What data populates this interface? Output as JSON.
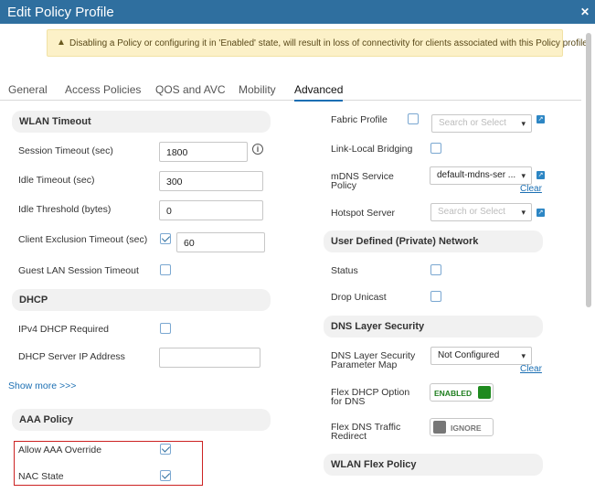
{
  "window": {
    "title": "Edit Policy Profile",
    "close_icon": "close-icon"
  },
  "alert": {
    "text": "Disabling a Policy or configuring it in 'Enabled' state, will result in loss of connectivity for clients associated with this Policy profile.",
    "icon": "warning-icon"
  },
  "tabs": [
    {
      "label": "General",
      "active": false
    },
    {
      "label": "Access Policies",
      "active": false
    },
    {
      "label": "QOS and AVC",
      "active": false
    },
    {
      "label": "Mobility",
      "active": false
    },
    {
      "label": "Advanced",
      "active": true
    }
  ],
  "left": {
    "wlan_timeout": {
      "title": "WLAN Timeout",
      "session_timeout": {
        "label": "Session Timeout (sec)",
        "value": "1800"
      },
      "idle_timeout": {
        "label": "Idle Timeout (sec)",
        "value": "300"
      },
      "idle_threshold": {
        "label": "Idle Threshold (bytes)",
        "value": "0"
      },
      "client_exclusion": {
        "label": "Client Exclusion Timeout (sec)",
        "checked": true,
        "value": "60"
      },
      "guest_lan": {
        "label": "Guest LAN Session Timeout",
        "checked": false
      }
    },
    "dhcp": {
      "title": "DHCP",
      "ipv4_required": {
        "label": "IPv4 DHCP Required",
        "checked": false
      },
      "server_ip": {
        "label": "DHCP Server IP Address",
        "value": ""
      }
    },
    "show_more": "Show more >>>",
    "aaa": {
      "title": "AAA Policy",
      "allow_override": {
        "label": "Allow AAA Override",
        "checked": true
      },
      "nac_state": {
        "label": "NAC State",
        "checked": true
      }
    }
  },
  "right": {
    "fabric_profile": {
      "label": "Fabric Profile",
      "checked": false,
      "placeholder": "Search or Select"
    },
    "link_local": {
      "label": "Link-Local Bridging",
      "checked": false
    },
    "mdns": {
      "label_line1": "mDNS Service",
      "label_line2": "Policy",
      "value": "default-mdns-ser ...",
      "clear": "Clear"
    },
    "hotspot": {
      "label": "Hotspot Server",
      "placeholder": "Search or Select"
    },
    "udn": {
      "title": "User Defined (Private) Network",
      "status": {
        "label": "Status",
        "checked": false
      },
      "drop_unicast": {
        "label": "Drop Unicast",
        "checked": false
      }
    },
    "dns": {
      "title": "DNS Layer Security",
      "param_map": {
        "label_line1": "DNS Layer Security",
        "label_line2": "Parameter Map",
        "value": "Not Configured",
        "clear": "Clear"
      },
      "flex_dhcp": {
        "label_line1": "Flex DHCP Option",
        "label_line2": "for DNS",
        "state": "ENABLED"
      },
      "flex_dns": {
        "label_line1": "Flex DNS Traffic",
        "label_line2": "Redirect",
        "state": "IGNORE"
      }
    },
    "wlan_flex": {
      "title": "WLAN Flex Policy"
    }
  }
}
